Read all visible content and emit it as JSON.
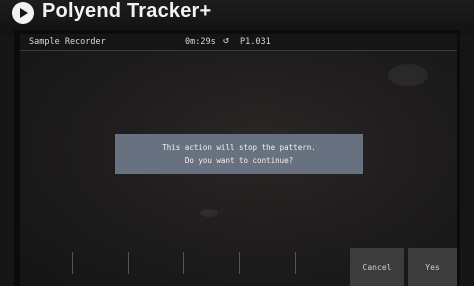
{
  "device": {
    "brand": "Polyend Tracker+"
  },
  "header": {
    "title": "Sample Recorder",
    "time": "0m:29s",
    "pattern": "P1.031"
  },
  "dialog": {
    "line1": "This action will stop the pattern.",
    "line2": "Do you want to continue?"
  },
  "buttons": {
    "cancel": "Cancel",
    "yes": "Yes"
  },
  "icons": [
    "polyend-logo-icon",
    "sync-icon"
  ],
  "colors": {
    "dialog_bg": "#68717f",
    "screen_bg": "#1d1b1b",
    "button_bg": "#3c3c3c"
  }
}
